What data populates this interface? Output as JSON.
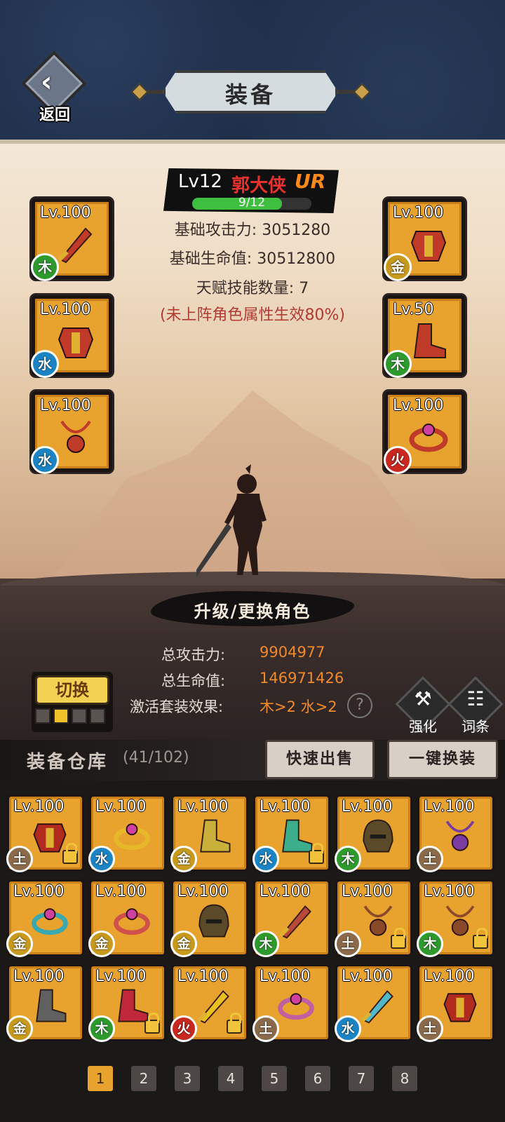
{
  "header": {
    "title": "装备",
    "back_label": "返回"
  },
  "hero": {
    "level": "Lv12",
    "name": "郭大侠",
    "rank": "UR",
    "progress_text": "9/12",
    "progress": 0.75,
    "stats": [
      "基础攻击力: 3051280",
      "基础生命值: 30512800",
      "天赋技能数量: 7"
    ],
    "note": "(未上阵角色属性生效80%)"
  },
  "left_slots": [
    {
      "level": "Lv.100",
      "element": "木",
      "element_color": "#2e9a2e",
      "icon": "sword-icon"
    },
    {
      "level": "Lv.100",
      "element": "水",
      "element_color": "#1b84c4",
      "icon": "armor-icon"
    },
    {
      "level": "Lv.100",
      "element": "水",
      "element_color": "#1b84c4",
      "icon": "necklace-icon"
    }
  ],
  "right_slots": [
    {
      "level": "Lv.100",
      "element": "金",
      "element_color": "#c79a1e",
      "icon": "armor-icon"
    },
    {
      "level": "Lv.50",
      "element": "木",
      "element_color": "#2e9a2e",
      "icon": "boots-icon"
    },
    {
      "level": "Lv.100",
      "element": "火",
      "element_color": "#c8281f",
      "icon": "ring-icon"
    }
  ],
  "change_role_label": "升级/更换角色",
  "totals": {
    "attack_label": "总攻击力:",
    "attack_value": "9904977",
    "hp_label": "总生命值:",
    "hp_value": "146971426",
    "set_label": "激活套装效果:",
    "set_value": "木>2 水>2"
  },
  "switch": {
    "label": "切换",
    "active_index": 1
  },
  "tools": {
    "enhance_label": "强化",
    "affix_label": "词条"
  },
  "warehouse": {
    "title": "装备仓库",
    "count": "(41/102)",
    "quick_sell": "快速出售",
    "one_click_equip": "一键换装",
    "items": [
      {
        "level": "Lv.100",
        "element": "土",
        "locked": true,
        "icon": "armor-icon",
        "tint": "#b02a1e"
      },
      {
        "level": "Lv.100",
        "element": "水",
        "locked": false,
        "icon": "ring-icon",
        "tint": "#e6b82a"
      },
      {
        "level": "Lv.100",
        "element": "金",
        "locked": false,
        "icon": "boots-icon",
        "tint": "#c9b03a"
      },
      {
        "level": "Lv.100",
        "element": "水",
        "locked": true,
        "icon": "boots-icon",
        "tint": "#3cae8c"
      },
      {
        "level": "Lv.100",
        "element": "木",
        "locked": false,
        "icon": "helmet-icon",
        "tint": "#5a4a2a"
      },
      {
        "level": "Lv.100",
        "element": "土",
        "locked": false,
        "icon": "necklace-icon",
        "tint": "#7a3ca0"
      },
      {
        "level": "Lv.100",
        "element": "金",
        "locked": false,
        "icon": "ring-icon",
        "tint": "#3aa8b0"
      },
      {
        "level": "Lv.100",
        "element": "金",
        "locked": false,
        "icon": "ring-icon",
        "tint": "#d0504a"
      },
      {
        "level": "Lv.100",
        "element": "金",
        "locked": false,
        "icon": "helmet-icon",
        "tint": "#5a4a2a"
      },
      {
        "level": "Lv.100",
        "element": "木",
        "locked": false,
        "icon": "sword-icon",
        "tint": "#b84a3a"
      },
      {
        "level": "Lv.100",
        "element": "土",
        "locked": true,
        "icon": "necklace-icon",
        "tint": "#8a4a2a"
      },
      {
        "level": "Lv.100",
        "element": "木",
        "locked": true,
        "icon": "necklace-icon",
        "tint": "#8a4a2a"
      },
      {
        "level": "Lv.100",
        "element": "金",
        "locked": false,
        "icon": "boots-icon",
        "tint": "#606060"
      },
      {
        "level": "Lv.100",
        "element": "木",
        "locked": true,
        "icon": "boots-icon",
        "tint": "#c0283a"
      },
      {
        "level": "Lv.100",
        "element": "火",
        "locked": true,
        "icon": "sword-icon",
        "tint": "#e8c020"
      },
      {
        "level": "Lv.100",
        "element": "土",
        "locked": false,
        "icon": "ring-icon",
        "tint": "#c060a0"
      },
      {
        "level": "Lv.100",
        "element": "水",
        "locked": false,
        "icon": "sword-icon",
        "tint": "#50b8c8"
      },
      {
        "level": "Lv.100",
        "element": "土",
        "locked": false,
        "icon": "armor-icon",
        "tint": "#b02a1e"
      }
    ]
  },
  "pagination": {
    "pages": [
      "1",
      "2",
      "3",
      "4",
      "5",
      "6",
      "7",
      "8"
    ],
    "current": "1"
  }
}
